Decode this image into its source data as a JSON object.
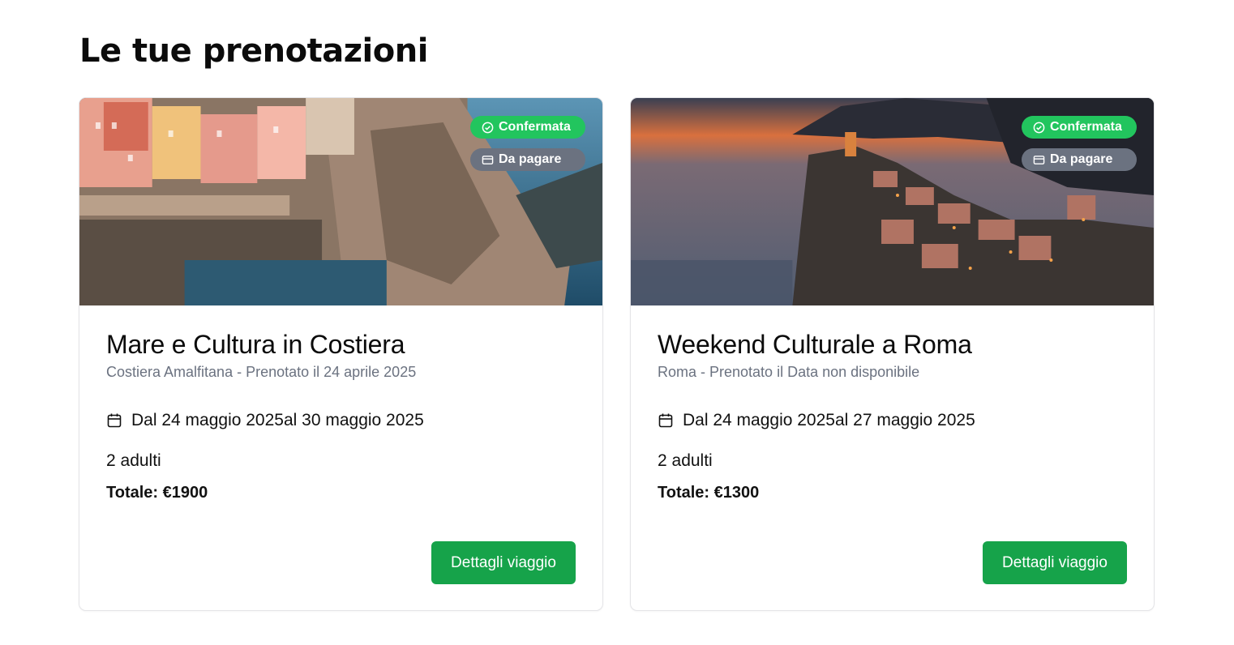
{
  "page": {
    "title": "Le tue prenotazioni"
  },
  "bookings": [
    {
      "title": "Mare e Cultura in Costiera",
      "subtitle": "Costiera Amalfitana - Prenotato il 24 aprile 2025",
      "dates": "Dal 24 maggio 2025al 30 maggio 2025",
      "guests": "2 adulti",
      "total": "Totale: €1900",
      "badge_status": "Confermata",
      "badge_payment": "Da pagare",
      "button": "Dettagli viaggio",
      "image": "coastal-village-photo"
    },
    {
      "title": "Weekend Culturale a Roma",
      "subtitle": "Roma - Prenotato il Data non disponibile",
      "dates": "Dal 24 maggio 2025al 27 maggio 2025",
      "guests": "2 adulti",
      "total": "Totale: €1300",
      "badge_status": "Confermata",
      "badge_payment": "Da pagare",
      "button": "Dettagli viaggio",
      "image": "sunset-village-photo"
    }
  ],
  "colors": {
    "confirmed": "#22c55e",
    "payment": "#6b7280",
    "button": "#16a34a"
  },
  "icons": {
    "status": "check-circle-icon",
    "payment": "credit-card-icon",
    "dates": "calendar-icon"
  }
}
